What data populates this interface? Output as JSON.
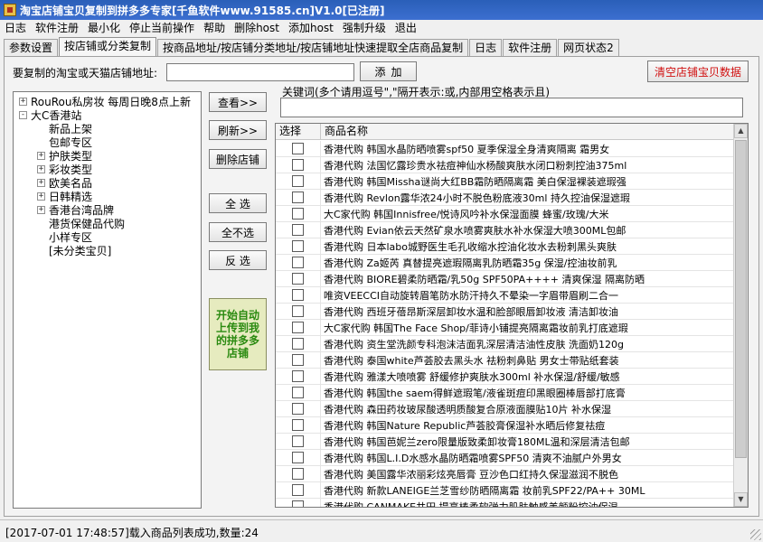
{
  "window": {
    "title": "淘宝店铺宝贝复制到拼多多专家[千鱼软件www.91585.cn]V1.0[已注册]"
  },
  "menu": [
    "日志",
    "软件注册",
    "最小化",
    "停止当前操作",
    "帮助",
    "删除host",
    "添加host",
    "强制升级",
    "退出"
  ],
  "tabs": [
    {
      "label": "参数设置",
      "active": false
    },
    {
      "label": "按店铺或分类复制",
      "active": true
    },
    {
      "label": "按商品地址/按店铺分类地址/按店铺地址快速提取全店商品复制",
      "active": false
    },
    {
      "label": "日志",
      "active": false
    },
    {
      "label": "软件注册",
      "active": false
    },
    {
      "label": "网页状态2",
      "active": false
    }
  ],
  "url": {
    "label": "要复制的淘宝或天猫店铺地址:",
    "value": "",
    "add_label": "添加",
    "clear_label": "清空店铺宝贝数据"
  },
  "tree": [
    {
      "label": "RouRou私房妆 每周日晚8点上新",
      "level": 0,
      "toggle": "+"
    },
    {
      "label": "大C香港站",
      "level": 0,
      "toggle": "-"
    },
    {
      "label": "新品上架",
      "level": 1,
      "toggle": ""
    },
    {
      "label": "包邮专区",
      "level": 1,
      "toggle": ""
    },
    {
      "label": "护肤类型",
      "level": 1,
      "toggle": "+"
    },
    {
      "label": "彩妆类型",
      "level": 1,
      "toggle": "+"
    },
    {
      "label": "欧美名品",
      "level": 1,
      "toggle": "+"
    },
    {
      "label": "日韩精选",
      "level": 1,
      "toggle": "+"
    },
    {
      "label": "香港台湾品牌",
      "level": 1,
      "toggle": "+"
    },
    {
      "label": "港货保健品代购",
      "level": 1,
      "toggle": ""
    },
    {
      "label": "小样专区",
      "level": 1,
      "toggle": ""
    },
    {
      "label": "[未分类宝贝]",
      "level": 1,
      "toggle": ""
    }
  ],
  "side_buttons": {
    "view": "查看>>",
    "refresh": "刷新>>",
    "delete_shop": "删除店铺",
    "select_all": "全 选",
    "select_none": "全不选",
    "invert": "反 选",
    "upload": "开始自动上传到我的拼多多店铺"
  },
  "keyword": {
    "label": "关键词(多个请用逗号\",\"隔开表示:或,内部用空格表示且)",
    "value": ""
  },
  "grid": {
    "headers": {
      "select": "选择",
      "name": "商品名称"
    },
    "rows": [
      "香港代购 韩国水晶防晒喷雾spf50 夏季保湿全身清爽隔离 霜男女",
      "香港代购 法国忆露珍贵水祛痘神仙水杨酸爽肤水闭口粉刺控油375ml",
      "香港代购 韩国Missha谜尚大红BB霜防晒隔离霜 美白保湿裸装遮瑕强",
      "香港代购 Revlon露华浓24小时不脱色粉底液30ml 持久控油保湿遮瑕",
      "大C家代购 韩国Innisfree/悦诗风吟补水保湿面膜 蜂蜜/玫瑰/大米",
      "香港代购 Evian依云天然矿泉水喷雾爽肤水补水保湿大喷300ML包邮",
      "香港代购 日本labo城野医生毛孔收缩水控油化妆水去粉刺黑头爽肤",
      "香港代购 Za姬芮 真替提亮遮瑕隔离乳防晒霜35g 保湿/控油妆前乳",
      "香港代购 BIORE碧柔防晒霜/乳50g SPF50PA++++ 清爽保湿 隔离防晒",
      "唯资VEECCI自动旋转眉笔防水防汗持久不晕染一字眉带眉刷二合一",
      "香港代购 西班牙蓓昂斯深层卸妆水温和脸部眼唇卸妆液 清洁卸妆油",
      "大C家代购 韩国The Face Shop/菲诗小铺提亮隔离霜妆前乳打底遮瑕",
      "香港代购 资生堂洗颜专科泡沫洁面乳深层清洁油性皮肤 洗面奶120g",
      "香港代购 泰国white芦荟胶去黑头水 祛粉刺鼻贴 男女士带贴纸套装",
      "香港代购 雅漾大喷喷雾 舒缓修护爽肤水300ml 补水保湿/舒缓/敏感",
      "香港代购 韩国the saem得鲜遮瑕笔/液雀斑痘印黑眼圈棒唇部打底膏",
      "香港代购 森田药妆玻尿酸透明质酸复合原液面膜贴10片 补水保湿",
      "香港代购 韩国Nature Republic芦荟胶膏保湿补水晒后修复祛痘",
      "香港代购 韩国芭妮兰zero限量版致柔卸妆膏180ML温和深层清洁包邮",
      "香港代购 韩国L.I.D水感水晶防晒霜喷雾SPF50 清爽不油腻户外男女",
      "香港代购 美国露华浓丽彩炫亮唇膏 豆沙色口红持久保湿滋润不脱色",
      "香港代购 新款LANEIGE兰芝雪纱防晒隔离霜 妆前乳SPF22/PA++ 30ML",
      "香港代购 CANMAKE井田 提亮棒柔软弹力肌肤触感美颜粉控油保湿"
    ]
  },
  "status": {
    "text": "[2017-07-01 17:48:57]载入商品列表成功,数量:24"
  }
}
